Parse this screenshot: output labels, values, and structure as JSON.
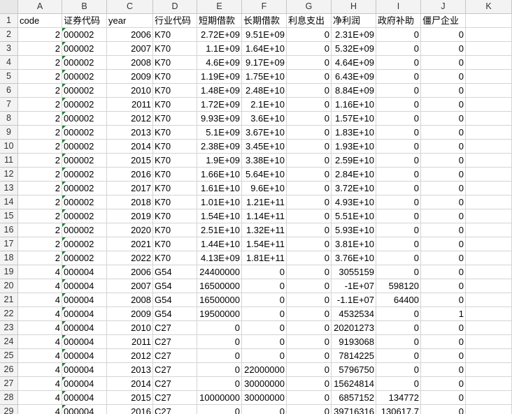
{
  "columns": [
    "A",
    "B",
    "C",
    "D",
    "E",
    "F",
    "G",
    "H",
    "I",
    "J",
    "K"
  ],
  "rows": [
    {
      "n": "1",
      "cells": [
        "code",
        "证券代码",
        "year",
        "行业代码",
        "短期借款",
        "长期借款",
        "利息支出",
        "净利润",
        "政府补助",
        "僵尸企业",
        ""
      ]
    },
    {
      "n": "2",
      "cells": [
        "2",
        "000002",
        "2006",
        "K70",
        "2.72E+09",
        "9.51E+09",
        "0",
        "2.31E+09",
        "0",
        "0",
        ""
      ]
    },
    {
      "n": "3",
      "cells": [
        "2",
        "000002",
        "2007",
        "K70",
        "1.1E+09",
        "1.64E+10",
        "0",
        "5.32E+09",
        "0",
        "0",
        ""
      ]
    },
    {
      "n": "4",
      "cells": [
        "2",
        "000002",
        "2008",
        "K70",
        "4.6E+09",
        "9.17E+09",
        "0",
        "4.64E+09",
        "0",
        "0",
        ""
      ]
    },
    {
      "n": "5",
      "cells": [
        "2",
        "000002",
        "2009",
        "K70",
        "1.19E+09",
        "1.75E+10",
        "0",
        "6.43E+09",
        "0",
        "0",
        ""
      ]
    },
    {
      "n": "6",
      "cells": [
        "2",
        "000002",
        "2010",
        "K70",
        "1.48E+09",
        "2.48E+10",
        "0",
        "8.84E+09",
        "0",
        "0",
        ""
      ]
    },
    {
      "n": "7",
      "cells": [
        "2",
        "000002",
        "2011",
        "K70",
        "1.72E+09",
        "2.1E+10",
        "0",
        "1.16E+10",
        "0",
        "0",
        ""
      ]
    },
    {
      "n": "8",
      "cells": [
        "2",
        "000002",
        "2012",
        "K70",
        "9.93E+09",
        "3.6E+10",
        "0",
        "1.57E+10",
        "0",
        "0",
        ""
      ]
    },
    {
      "n": "9",
      "cells": [
        "2",
        "000002",
        "2013",
        "K70",
        "5.1E+09",
        "3.67E+10",
        "0",
        "1.83E+10",
        "0",
        "0",
        ""
      ]
    },
    {
      "n": "10",
      "cells": [
        "2",
        "000002",
        "2014",
        "K70",
        "2.38E+09",
        "3.45E+10",
        "0",
        "1.93E+10",
        "0",
        "0",
        ""
      ]
    },
    {
      "n": "11",
      "cells": [
        "2",
        "000002",
        "2015",
        "K70",
        "1.9E+09",
        "3.38E+10",
        "0",
        "2.59E+10",
        "0",
        "0",
        ""
      ]
    },
    {
      "n": "12",
      "cells": [
        "2",
        "000002",
        "2016",
        "K70",
        "1.66E+10",
        "5.64E+10",
        "0",
        "2.84E+10",
        "0",
        "0",
        ""
      ]
    },
    {
      "n": "13",
      "cells": [
        "2",
        "000002",
        "2017",
        "K70",
        "1.61E+10",
        "9.6E+10",
        "0",
        "3.72E+10",
        "0",
        "0",
        ""
      ]
    },
    {
      "n": "14",
      "cells": [
        "2",
        "000002",
        "2018",
        "K70",
        "1.01E+10",
        "1.21E+11",
        "0",
        "4.93E+10",
        "0",
        "0",
        ""
      ]
    },
    {
      "n": "15",
      "cells": [
        "2",
        "000002",
        "2019",
        "K70",
        "1.54E+10",
        "1.14E+11",
        "0",
        "5.51E+10",
        "0",
        "0",
        ""
      ]
    },
    {
      "n": "16",
      "cells": [
        "2",
        "000002",
        "2020",
        "K70",
        "2.51E+10",
        "1.32E+11",
        "0",
        "5.93E+10",
        "0",
        "0",
        ""
      ]
    },
    {
      "n": "17",
      "cells": [
        "2",
        "000002",
        "2021",
        "K70",
        "1.44E+10",
        "1.54E+11",
        "0",
        "3.81E+10",
        "0",
        "0",
        ""
      ]
    },
    {
      "n": "18",
      "cells": [
        "2",
        "000002",
        "2022",
        "K70",
        "4.13E+09",
        "1.81E+11",
        "0",
        "3.76E+10",
        "0",
        "0",
        ""
      ]
    },
    {
      "n": "19",
      "cells": [
        "4",
        "000004",
        "2006",
        "G54",
        "24400000",
        "0",
        "0",
        "3055159",
        "0",
        "0",
        ""
      ]
    },
    {
      "n": "20",
      "cells": [
        "4",
        "000004",
        "2007",
        "G54",
        "16500000",
        "0",
        "0",
        "-1E+07",
        "598120",
        "0",
        ""
      ]
    },
    {
      "n": "21",
      "cells": [
        "4",
        "000004",
        "2008",
        "G54",
        "16500000",
        "0",
        "0",
        "-1.1E+07",
        "64400",
        "0",
        ""
      ]
    },
    {
      "n": "22",
      "cells": [
        "4",
        "000004",
        "2009",
        "G54",
        "19500000",
        "0",
        "0",
        "4532534",
        "0",
        "1",
        ""
      ]
    },
    {
      "n": "23",
      "cells": [
        "4",
        "000004",
        "2010",
        "C27",
        "0",
        "0",
        "0",
        "20201273",
        "0",
        "0",
        ""
      ]
    },
    {
      "n": "24",
      "cells": [
        "4",
        "000004",
        "2011",
        "C27",
        "0",
        "0",
        "0",
        "9193068",
        "0",
        "0",
        ""
      ]
    },
    {
      "n": "25",
      "cells": [
        "4",
        "000004",
        "2012",
        "C27",
        "0",
        "0",
        "0",
        "7814225",
        "0",
        "0",
        ""
      ]
    },
    {
      "n": "26",
      "cells": [
        "4",
        "000004",
        "2013",
        "C27",
        "0",
        "22000000",
        "0",
        "5796750",
        "0",
        "0",
        ""
      ]
    },
    {
      "n": "27",
      "cells": [
        "4",
        "000004",
        "2014",
        "C27",
        "0",
        "30000000",
        "0",
        "15624814",
        "0",
        "0",
        ""
      ]
    },
    {
      "n": "28",
      "cells": [
        "4",
        "000004",
        "2015",
        "C27",
        "10000000",
        "30000000",
        "0",
        "6857152",
        "134772",
        "0",
        ""
      ]
    },
    {
      "n": "29",
      "cells": [
        "4",
        "000004",
        "2016",
        "C27",
        "0",
        "0",
        "0",
        "39716316",
        "130617.7",
        "0",
        ""
      ]
    }
  ],
  "colors": {
    "header_bg": "#f3f3f3",
    "grid": "#d4d4d4",
    "text_flag": "#1e7e34"
  }
}
